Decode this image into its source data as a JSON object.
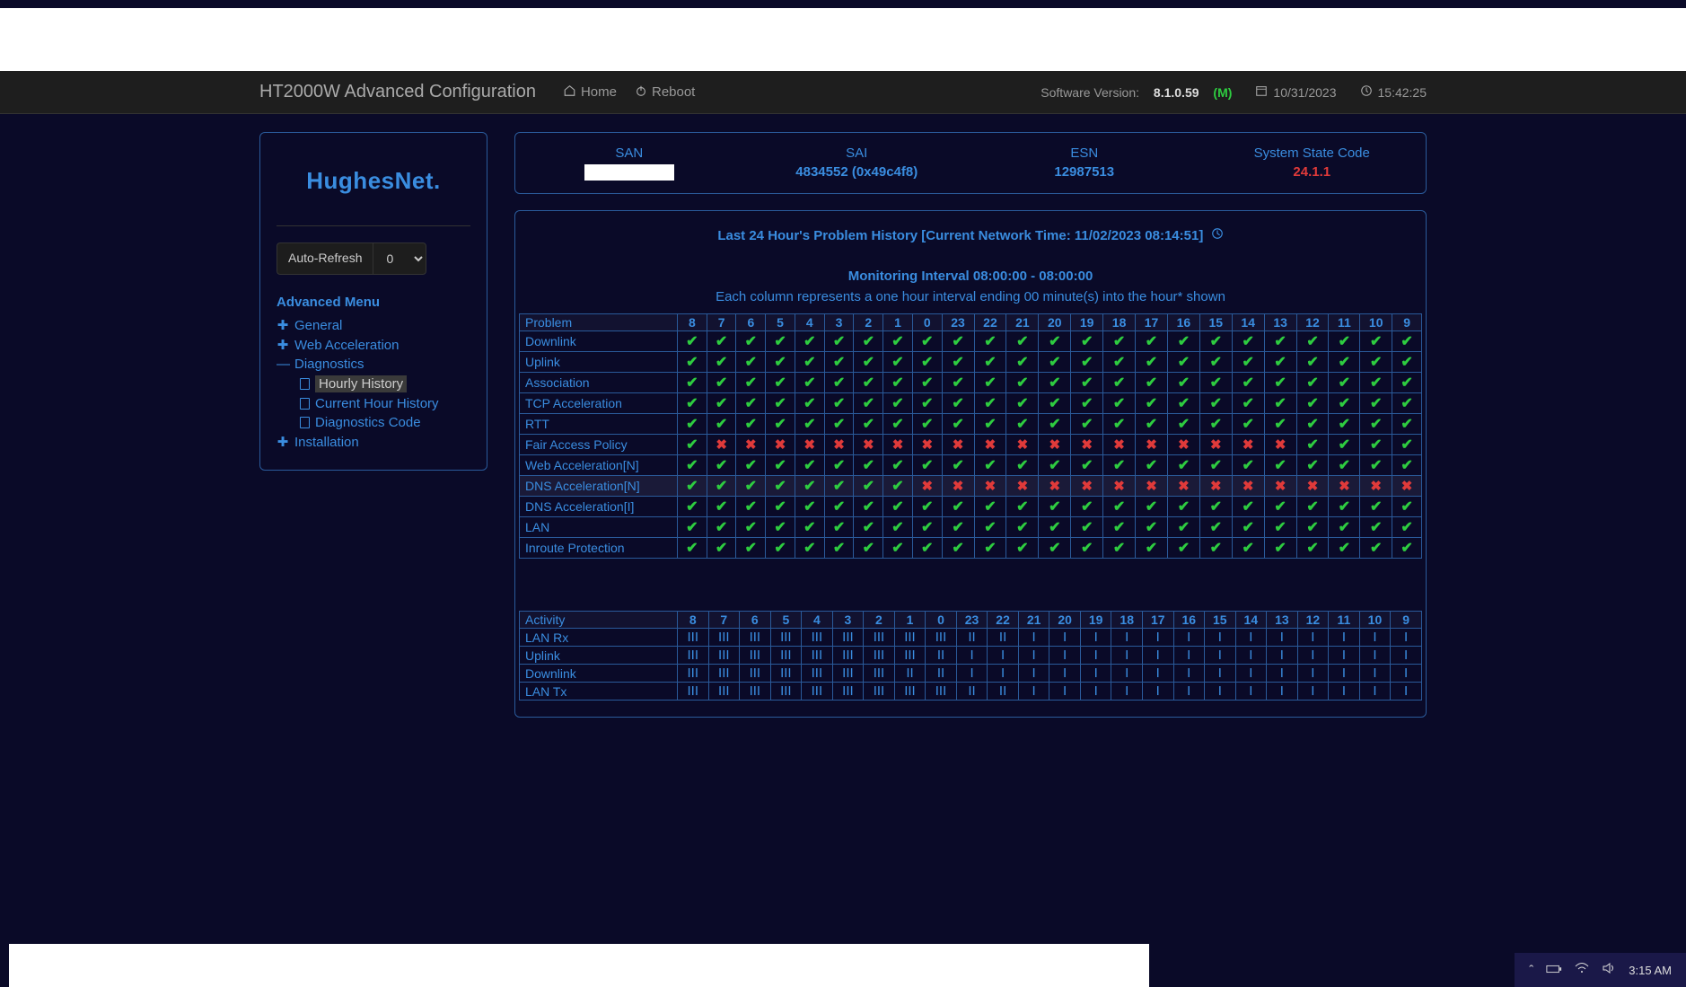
{
  "header": {
    "title": "HT2000W Advanced Configuration",
    "home": "Home",
    "reboot": "Reboot",
    "sw_label": "Software Version:",
    "sw_version": "8.1.0.59",
    "sw_flag": "(M)",
    "date": "10/31/2023",
    "time": "15:42:25"
  },
  "sidebar": {
    "logo": "HughesNet.",
    "auto_refresh_label": "Auto-Refresh",
    "auto_refresh_value": "0",
    "menu_head": "Advanced Menu",
    "items": {
      "general": "General",
      "web_accel": "Web Acceleration",
      "diagnostics": "Diagnostics",
      "hourly": "Hourly History",
      "current_hour": "Current Hour History",
      "diag_code": "Diagnostics Code",
      "installation": "Installation"
    }
  },
  "info": {
    "san_label": "SAN",
    "san_value": "",
    "sai_label": "SAI",
    "sai_value": "4834552 (0x49c4f8)",
    "esn_label": "ESN",
    "esn_value": "12987513",
    "state_label": "System State Code",
    "state_value": "24.1.1"
  },
  "hist": {
    "title": "Last 24 Hour's Problem History [Current Network Time: 11/02/2023 08:14:51]",
    "sub": "Monitoring Interval 08:00:00 - 08:00:00",
    "desc": "Each column represents a one hour interval ending 00 minute(s) into the hour* shown",
    "col_head": "Problem",
    "hours": [
      "8",
      "7",
      "6",
      "5",
      "4",
      "3",
      "2",
      "1",
      "0",
      "23",
      "22",
      "21",
      "20",
      "19",
      "18",
      "17",
      "16",
      "15",
      "14",
      "13",
      "12",
      "11",
      "10",
      "9"
    ]
  },
  "problems": [
    {
      "name": "Downlink",
      "v": [
        1,
        1,
        1,
        1,
        1,
        1,
        1,
        1,
        1,
        1,
        1,
        1,
        1,
        1,
        1,
        1,
        1,
        1,
        1,
        1,
        1,
        1,
        1,
        1
      ]
    },
    {
      "name": "Uplink",
      "v": [
        1,
        1,
        1,
        1,
        1,
        1,
        1,
        1,
        1,
        1,
        1,
        1,
        1,
        1,
        1,
        1,
        1,
        1,
        1,
        1,
        1,
        1,
        1,
        1
      ]
    },
    {
      "name": "Association",
      "v": [
        1,
        1,
        1,
        1,
        1,
        1,
        1,
        1,
        1,
        1,
        1,
        1,
        1,
        1,
        1,
        1,
        1,
        1,
        1,
        1,
        1,
        1,
        1,
        1
      ]
    },
    {
      "name": "TCP Acceleration",
      "v": [
        1,
        1,
        1,
        1,
        1,
        1,
        1,
        1,
        1,
        1,
        1,
        1,
        1,
        1,
        1,
        1,
        1,
        1,
        1,
        1,
        1,
        1,
        1,
        1
      ]
    },
    {
      "name": "RTT",
      "v": [
        1,
        1,
        1,
        1,
        1,
        1,
        1,
        1,
        1,
        1,
        1,
        1,
        1,
        1,
        1,
        1,
        1,
        1,
        1,
        1,
        1,
        1,
        1,
        1
      ]
    },
    {
      "name": "Fair Access Policy",
      "v": [
        1,
        0,
        0,
        0,
        0,
        0,
        0,
        0,
        0,
        0,
        0,
        0,
        0,
        0,
        0,
        0,
        0,
        0,
        0,
        0,
        1,
        1,
        1,
        1
      ]
    },
    {
      "name": "Web Acceleration[N]",
      "v": [
        1,
        1,
        1,
        1,
        1,
        1,
        1,
        1,
        1,
        1,
        1,
        1,
        1,
        1,
        1,
        1,
        1,
        1,
        1,
        1,
        1,
        1,
        1,
        1
      ]
    },
    {
      "name": "DNS Acceleration[N]",
      "v": [
        1,
        1,
        1,
        1,
        1,
        1,
        1,
        1,
        0,
        0,
        0,
        0,
        0,
        0,
        0,
        0,
        0,
        0,
        0,
        0,
        0,
        0,
        0,
        0
      ],
      "hover": true
    },
    {
      "name": "DNS Acceleration[I]",
      "v": [
        1,
        1,
        1,
        1,
        1,
        1,
        1,
        1,
        1,
        1,
        1,
        1,
        1,
        1,
        1,
        1,
        1,
        1,
        1,
        1,
        1,
        1,
        1,
        1
      ]
    },
    {
      "name": "LAN",
      "v": [
        1,
        1,
        1,
        1,
        1,
        1,
        1,
        1,
        1,
        1,
        1,
        1,
        1,
        1,
        1,
        1,
        1,
        1,
        1,
        1,
        1,
        1,
        1,
        1
      ]
    },
    {
      "name": "Inroute Protection",
      "v": [
        1,
        1,
        1,
        1,
        1,
        1,
        1,
        1,
        1,
        1,
        1,
        1,
        1,
        1,
        1,
        1,
        1,
        1,
        1,
        1,
        1,
        1,
        1,
        1
      ]
    }
  ],
  "activity": {
    "col_head": "Activity",
    "hours": [
      "8",
      "7",
      "6",
      "5",
      "4",
      "3",
      "2",
      "1",
      "0",
      "23",
      "22",
      "21",
      "20",
      "19",
      "18",
      "17",
      "16",
      "15",
      "14",
      "13",
      "12",
      "11",
      "10",
      "9"
    ],
    "rows": [
      {
        "name": "LAN Rx",
        "v": [
          "III",
          "III",
          "III",
          "III",
          "III",
          "III",
          "III",
          "III",
          "III",
          "II",
          "II",
          "I",
          "I",
          "I",
          "I",
          "I",
          "I",
          "I",
          "I",
          "I",
          "I",
          "I",
          "I",
          "I"
        ]
      },
      {
        "name": "Uplink",
        "v": [
          "III",
          "III",
          "III",
          "III",
          "III",
          "III",
          "III",
          "III",
          "II",
          "I",
          "I",
          "I",
          "I",
          "I",
          "I",
          "I",
          "I",
          "I",
          "I",
          "I",
          "I",
          "I",
          "I",
          "I"
        ]
      },
      {
        "name": "Downlink",
        "v": [
          "III",
          "III",
          "III",
          "III",
          "III",
          "III",
          "III",
          "II",
          "II",
          "I",
          "I",
          "I",
          "I",
          "I",
          "I",
          "I",
          "I",
          "I",
          "I",
          "I",
          "I",
          "I",
          "I",
          "I"
        ]
      },
      {
        "name": "LAN Tx",
        "v": [
          "III",
          "III",
          "III",
          "III",
          "III",
          "III",
          "III",
          "III",
          "III",
          "II",
          "II",
          "I",
          "I",
          "I",
          "I",
          "I",
          "I",
          "I",
          "I",
          "I",
          "I",
          "I",
          "I",
          "I"
        ]
      }
    ]
  },
  "taskbar": {
    "time": "3:15 AM"
  }
}
